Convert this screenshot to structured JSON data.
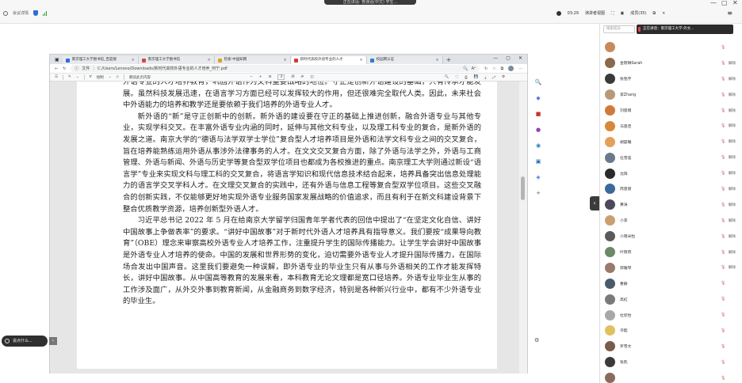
{
  "top": {
    "speaker_pill": "正在讲话: 普通话(中文) 学生...",
    "left_items": [
      "会议详情",
      "",
      ""
    ],
    "time": "03:29",
    "view": "演讲者视图",
    "participants": "成员(35)",
    "close_text": "×",
    "win_min": "—",
    "win_max": "▢",
    "win_close": "✕"
  },
  "browser": {
    "tabs": [
      {
        "label": "南京理工大学图书馆_百度搜",
        "color": "#2d6be4",
        "active": false
      },
      {
        "label": "南京理工大学图书馆",
        "color": "#d64545",
        "active": false
      },
      {
        "label": "检索-中国知网",
        "color": "#e0a020",
        "active": false
      },
      {
        "label": "新时代高校外语专业的人才",
        "color": "#d33a3a",
        "active": true
      },
      {
        "label": "校园网认证",
        "color": "#2f7ad6",
        "active": false
      }
    ],
    "new_tab": "+",
    "address_prefix": "文件",
    "address": "C:/Users/Lenovo/Downloads/新时代高校外语专业的人才培养_何宁.pdf",
    "toolbar": {
      "draw": "绘制",
      "read_aloud": "朗读此页内容",
      "minus": "−",
      "plus": "+",
      "page_current": "3",
      "page_total": "/6"
    }
  },
  "pdf": {
    "paragraphs": [
      {
        "cont": true,
        "text": "外语专业的人才培养教育，巩固外语作为文科重要战略的地位。守正是创新外语建设的基础，只有传承才能发展。虽然科技发展迅速，在语言学习方面已经可以发挥较大的作用，但还很难完全取代人类。因此，未来社会中外语能力的培养和教学还是要依赖于我们培养的外语专业人才。"
      },
      {
        "cont": false,
        "text": "新外语的“新”是守正创新中的创新。新外语的建设要在守正的基础上推进创新，融合外语专业与其他专业，实现学科交叉。在丰富外语专业内涵的同时，延伸与其他文科专业，以及理工科专业的复合，是新外语的发展之道。南京大学的“德语与法学双学士学位”复合型人才培养项目是外语和法学文科专业之间的交叉复合，旨在培养能熟练运用外语从事涉外法律事务的人才。在文文交叉复合方面，除了外语与法学之外，外语与工商管理、外语与新闻、外语与历史学等复合型双学位项目也都成为各校推进的重点。南京理工大学则通过新设“语言学”专业来实现文科与理工科的交叉复合，将语言学知识和现代信息技术结合起来，培养具备突出信息处理能力的语言学交叉学科人才。在文理交叉复合的实践中，还有外语与信息工程等复合型双学位项目。这些交叉融合的创新实践，不仅能够更好地实现外语专业服务国家发展战略的价值追求，而且有利于在新文科建设背景下整合优质教学资源，培养创新型外语人才。"
      },
      {
        "cont": false,
        "text": "习近平总书记 2022 年 5 月在给南京大学留学归国青年学者代表的回信中提出了“在坚定文化自信、讲好中国故事上争做表率”的要求。“讲好中国故事”对于新时代外语人才培养具有指导意义。我们要按“成果导向教育”（OBE）理念来审察高校外语专业人才培养工作，注重提升学生的国际传播能力。让学生学会讲好中国故事是外语专业人才培养的使命。中国的发展和世界形势的变化，迫切需要外语专业人才提升国际传播力，在国际场合发出中国声音。这里我们要避免一种误解，即外语专业的毕业生只有从事与外语相关的工作才能发挥特长，讲好中国故事。从中国高等教育的发展来看，本科教育无论文理都是宽口径培养。外语专业毕业生从事的工作涉及面广，从外交外事到教育新闻，从金融商务到数字经济，特别是各种新兴行业中，都有不少外语专业的毕业生。"
      }
    ]
  },
  "ui": {
    "collapse": "‹",
    "tip": "说点什么...",
    "tip_close": "‹"
  },
  "panel": {
    "search_placeholder": "搜索成员",
    "speaking": "正在讲话：南京理工大学-外文...",
    "participants": [
      {
        "name": "",
        "label": "",
        "color": "#c88a5a"
      },
      {
        "name": "金晓琳Sarah",
        "label": "解除",
        "color": "#8a6a4a"
      },
      {
        "name": "张弛宇",
        "label": "解除",
        "color": "#3a3a3a"
      },
      {
        "name": "李Zhang",
        "label": "解除",
        "color": "#b59a7a"
      },
      {
        "name": "刘思雨",
        "label": "解除",
        "color": "#d07a3a"
      },
      {
        "name": "马思佳",
        "label": "解除",
        "color": "#d8883a"
      },
      {
        "name": "胡晨曦",
        "label": "解除",
        "color": "#e4a05a"
      },
      {
        "name": "任雪莲",
        "label": "解除",
        "color": "#6a7a8a"
      },
      {
        "name": "沈阳",
        "label": "解除",
        "color": "#2a2a2a"
      },
      {
        "name": "周思丽",
        "label": "解除",
        "color": "#3a6a9a"
      },
      {
        "name": "黄涛",
        "label": "解除",
        "color": "#4a4a5a"
      },
      {
        "name": "小李",
        "label": "解除",
        "color": "#caa070"
      },
      {
        "name": "小雨米粒",
        "label": "解除",
        "color": "#5a5a5a"
      },
      {
        "name": "叶晓燕",
        "label": "解除",
        "color": "#6a8a6a"
      },
      {
        "name": "郭雅琴",
        "label": "解除",
        "color": "#9a7a6a"
      },
      {
        "name": "曹静",
        "label": "",
        "color": "#4a5a6a"
      },
      {
        "name": "高虹",
        "label": "",
        "color": "#7a7a7a"
      },
      {
        "name": "杜欣怡",
        "label": "",
        "color": "#a8a8a8"
      },
      {
        "name": "许超",
        "label": "",
        "color": "#e0c060"
      },
      {
        "name": "罗雪文",
        "label": "",
        "color": "#7a5a4a"
      },
      {
        "name": "张凯",
        "label": "",
        "color": "#3a3a3a"
      },
      {
        "name": "",
        "label": "",
        "color": "#8a6a5a"
      }
    ]
  }
}
